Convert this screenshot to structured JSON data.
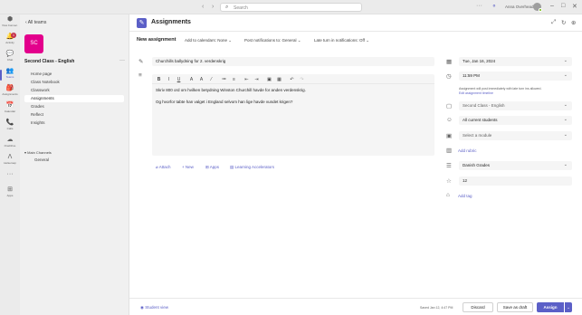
{
  "topbar": {
    "search_placeholder": "Search",
    "user_name": "Anna Overhead",
    "nav_back": "‹",
    "nav_forward": "›",
    "more": "···",
    "minimize": "–",
    "maximize": "□",
    "close": "✕"
  },
  "rail": {
    "items": [
      {
        "label": "Viva Connec.",
        "icon": "⬢"
      },
      {
        "label": "Activity",
        "icon": "🔔",
        "badge": "1"
      },
      {
        "label": "Chat",
        "icon": "💬"
      },
      {
        "label": "Teams",
        "icon": "👥",
        "active": true
      },
      {
        "label": "Assignments",
        "icon": "🎒"
      },
      {
        "label": "Calendar",
        "icon": "📅"
      },
      {
        "label": "Calls",
        "icon": "📞"
      },
      {
        "label": "OneDrive",
        "icon": "☁"
      },
      {
        "label": "Helsemap",
        "icon": "Ʌ"
      },
      {
        "label": "",
        "icon": "···"
      },
      {
        "label": "Apps",
        "icon": "⊞"
      }
    ]
  },
  "classbar": {
    "back_label": "All teams",
    "avatar_initials": "SC",
    "avatar_color": "#e3008c",
    "class_name": "Second Class - English",
    "nav": [
      "Home page",
      "Class Notebook",
      "Classwork",
      "Assignments",
      "Grades",
      "Reflect",
      "Insights"
    ],
    "active_nav": "Assignments",
    "channels_label": "Main Channels",
    "channel_general": "General"
  },
  "header": {
    "title": "Assignments"
  },
  "subbar": {
    "new_assignment": "New assignment",
    "add_to_calendars": "Add to calendars: None",
    "post_notifications": "Post notifications to: General",
    "late_turn_in": "Late turn in notifications: Off"
  },
  "form": {
    "title_value": "Churchills ballydning for 2. verdenskrig",
    "toolbar": [
      "B",
      "I",
      "U",
      "A",
      "A",
      "⁄",
      "≔",
      "≡",
      "⇤",
      "⇥",
      "▣",
      "▦",
      "↶",
      "↷"
    ],
    "instructions": [
      "Skriv 800 ord om hvilken betydning Winston Churchill havde for anden verdenskrig.",
      "Og hvorfor tabte han valget i England selvom han lige havde vundet krigen?"
    ],
    "actions": {
      "attach": "Attach",
      "new": "New",
      "apps": "Apps",
      "learning_accelerators": "Learning Accelerators"
    },
    "due_date": "Tue, Jan 16, 2024",
    "due_time": "11:59 PM",
    "schedule_note": "Assignment will post immediately with late turn ins allowed.",
    "schedule_link": "Edit assignment timeline",
    "class_select": "Second Class - English",
    "students_select": "All current students",
    "module_placeholder": "Select a module",
    "add_rubric": "Add rubric",
    "grading_scheme": "Danish Grades",
    "points": "12",
    "add_tag": "Add tag"
  },
  "footer": {
    "student_view": "Student view",
    "saved_status": "Saved Jan 12, 4:47 PM",
    "discard": "Discard",
    "save_draft": "Save as draft",
    "assign": "Assign",
    "assign_more": "⌄"
  },
  "colors": {
    "accent": "#5b5fc7",
    "class_avatar": "#e3008c"
  }
}
